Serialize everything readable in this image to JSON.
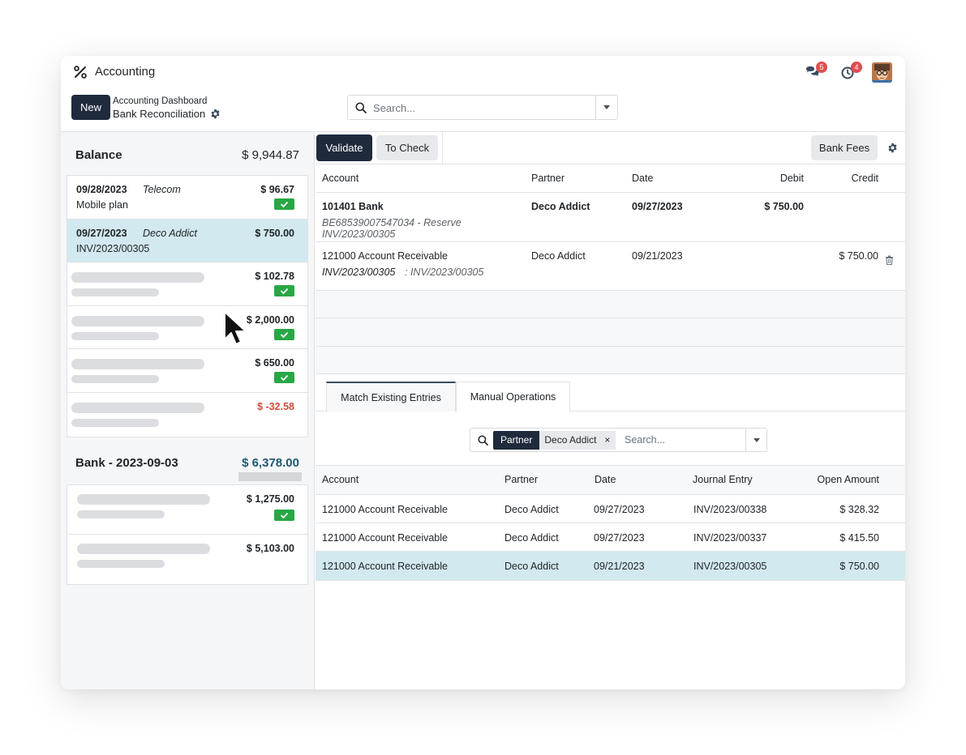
{
  "app": {
    "title": "Accounting",
    "icon": "percent-icon"
  },
  "systray": {
    "messages_count": "5",
    "activities_count": "4"
  },
  "control": {
    "new_label": "New",
    "breadcrumb_parent": "Accounting Dashboard",
    "breadcrumb_current": "Bank Reconciliation",
    "search_placeholder": "Search..."
  },
  "left": {
    "balance_label": "Balance",
    "balance_amount": "$ 9,944.87",
    "statements": [
      {
        "date": "09/28/2023",
        "partner": "Telecom",
        "label": "Mobile plan",
        "amount": "$ 96.67",
        "checked": true
      },
      {
        "date": "09/27/2023",
        "partner": "Deco Addict",
        "label": "INV/2023/00305",
        "amount": "$ 750.00",
        "checked": false,
        "active": true
      },
      {
        "amount": "$ 102.78",
        "checked": true
      },
      {
        "amount": "$ 2,000.00",
        "checked": true
      },
      {
        "amount": "$ 650.00",
        "checked": true
      },
      {
        "amount": "$ -32.58",
        "checked": false
      }
    ],
    "bank_label": "Bank - 2023-09-03",
    "bank_amount": "$ 6,378.00",
    "bank_lines": [
      {
        "amount": "$ 1,275.00",
        "checked": true
      },
      {
        "amount": "$ 5,103.00",
        "checked": false
      }
    ]
  },
  "toolbar": {
    "validate_label": "Validate",
    "tocheck_label": "To Check",
    "bankfees_label": "Bank Fees"
  },
  "lines": {
    "headers": {
      "account": "Account",
      "partner": "Partner",
      "date": "Date",
      "debit": "Debit",
      "credit": "Credit"
    },
    "rows": [
      {
        "account": "101401 Bank",
        "detail1": "BE68539007547034 - Reserve",
        "detail2": "INV/2023/00305",
        "partner": "Deco Addict",
        "date": "09/27/2023",
        "debit": "$ 750.00",
        "credit": ""
      },
      {
        "account": "121000 Account Receivable",
        "detail1": "INV/2023/00305",
        "detail2": ": INV/2023/00305",
        "partner": "Deco Addict",
        "date": "09/21/2023",
        "debit": "",
        "credit": "$ 750.00"
      }
    ]
  },
  "tabs": {
    "match": "Match Existing Entries",
    "manual": "Manual Operations"
  },
  "match_search": {
    "facet_key": "Partner",
    "facet_value": "Deco Addict",
    "facet_remove": "×",
    "placeholder": "Search..."
  },
  "match": {
    "headers": {
      "account": "Account",
      "partner": "Partner",
      "date": "Date",
      "journal": "Journal Entry",
      "open": "Open Amount"
    },
    "rows": [
      {
        "account": "121000 Account Receivable",
        "partner": "Deco Addict",
        "date": "09/27/2023",
        "journal": "INV/2023/00338",
        "open": "$ 328.32"
      },
      {
        "account": "121000 Account Receivable",
        "partner": "Deco Addict",
        "date": "09/27/2023",
        "journal": "INV/2023/00337",
        "open": "$ 415.50"
      },
      {
        "account": "121000 Account Receivable",
        "partner": "Deco Addict",
        "date": "09/21/2023",
        "journal": "INV/2023/00305",
        "open": "$ 750.00",
        "selected": true
      }
    ]
  },
  "colors": {
    "primary": "#1f2a3c",
    "selected_row": "#d2e9ef",
    "success": "#28a745",
    "danger": "#d44c3c",
    "badge": "#e04e4e"
  }
}
